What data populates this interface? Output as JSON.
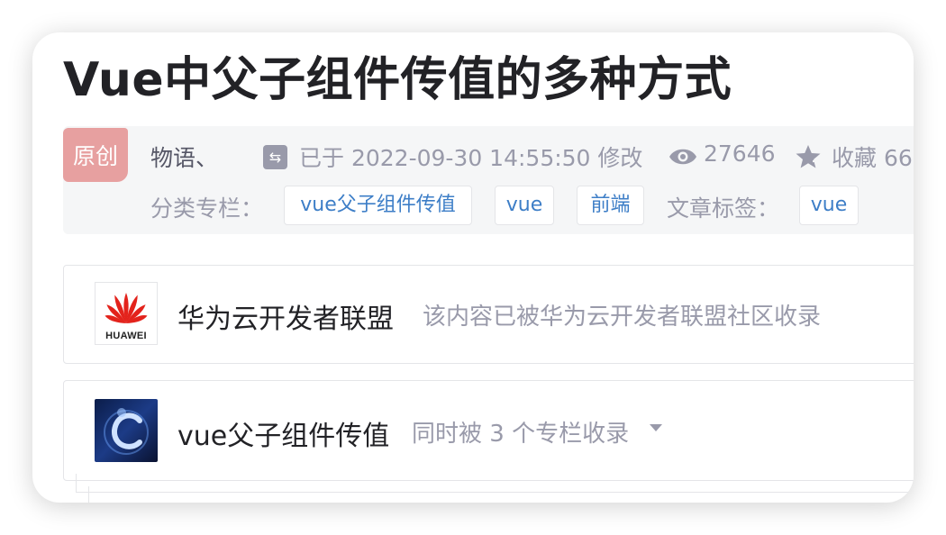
{
  "article": {
    "title": "Vue中父子组件传值的多种方式",
    "badge": "原创",
    "author": "物语、",
    "modified": "已于 2022-09-30 14:55:50 修改",
    "views": "27646",
    "favorites": "收藏 66",
    "category_label": "分类专栏：",
    "categories": [
      "vue父子组件传值",
      "vue",
      "前端"
    ],
    "tag_label": "文章标签：",
    "tags": [
      "vue"
    ]
  },
  "included_by": {
    "name": "华为云开发者联盟",
    "description": "该内容已被华为云开发者联盟社区收录",
    "logo_text": "HUAWEI"
  },
  "column": {
    "name": "vue父子组件传值",
    "description": "同时被 3 个专栏收录"
  },
  "icons": {
    "modify": "modify-icon",
    "views": "eye-icon",
    "favorite": "star-icon",
    "dropdown": "caret-down-icon"
  },
  "colors": {
    "badge_bg": "#e7a0a0",
    "tag_text": "#3d7ec7",
    "muted_text": "#999aaa",
    "huawei_red": "#e3231c"
  }
}
